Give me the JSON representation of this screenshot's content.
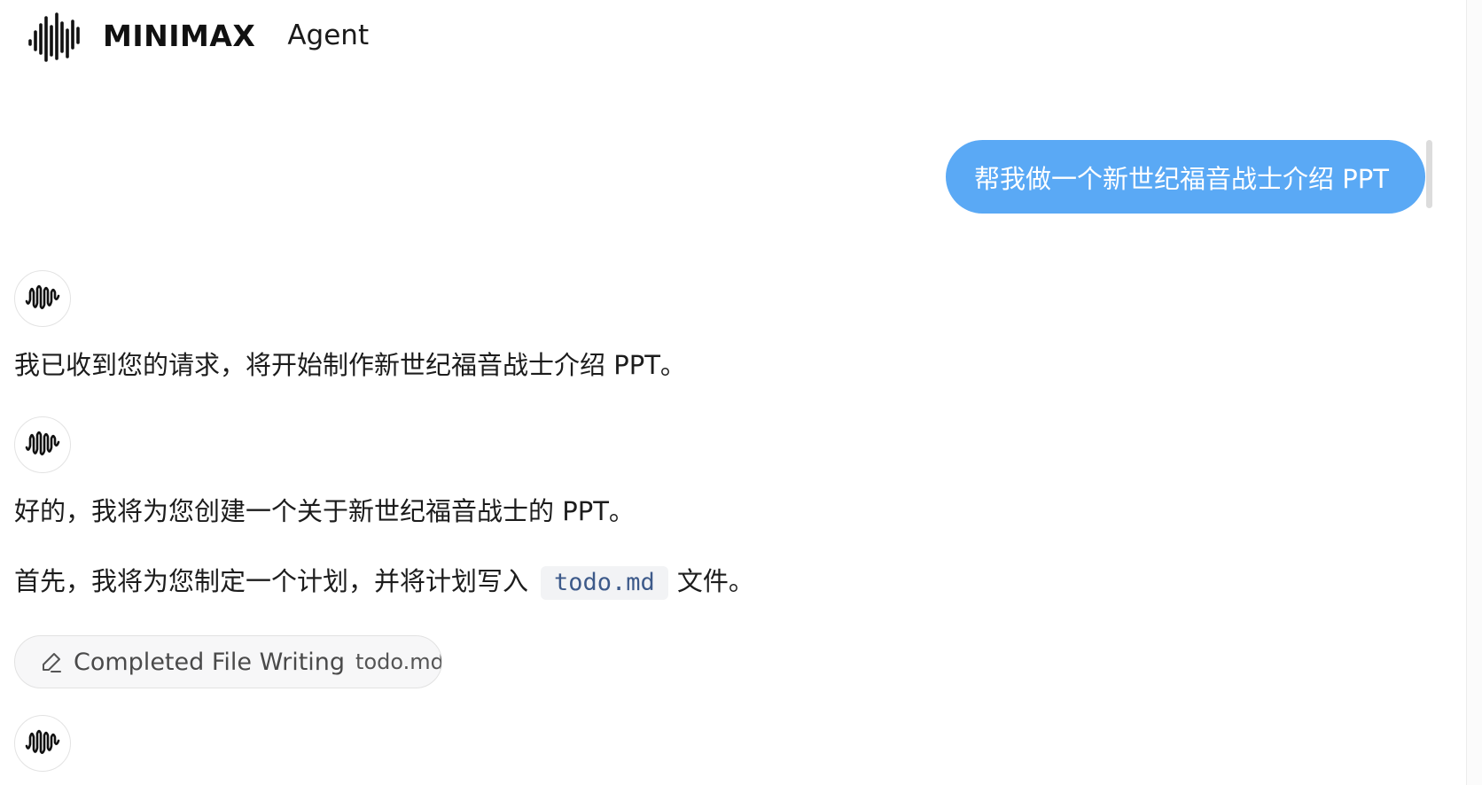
{
  "header": {
    "brand_name": "MINIMAX",
    "product_name": "Agent",
    "logo_icon": "waveform-logo-icon"
  },
  "conversation": {
    "user_message": "帮我做一个新世纪福音战士介绍 PPT",
    "agent_messages": [
      {
        "text": "我已收到您的请求，将开始制作新世纪福音战士介绍 PPT。"
      },
      {
        "text": "好的，我将为您创建一个关于新世纪福音战士的 PPT。"
      },
      {
        "before_code": "首先，我将为您制定一个计划，并将计划写入",
        "code": "todo.md",
        "after_code": "文件。"
      }
    ],
    "tool_status": {
      "icon": "pencil-icon",
      "label": "Completed File Writing",
      "file": "todo.md"
    }
  },
  "colors": {
    "user_bubble": "#5aa9f5",
    "inline_code_text": "#3d5a8a",
    "inline_code_bg": "#f2f3f5",
    "chip_bg": "#f7f7f8"
  }
}
